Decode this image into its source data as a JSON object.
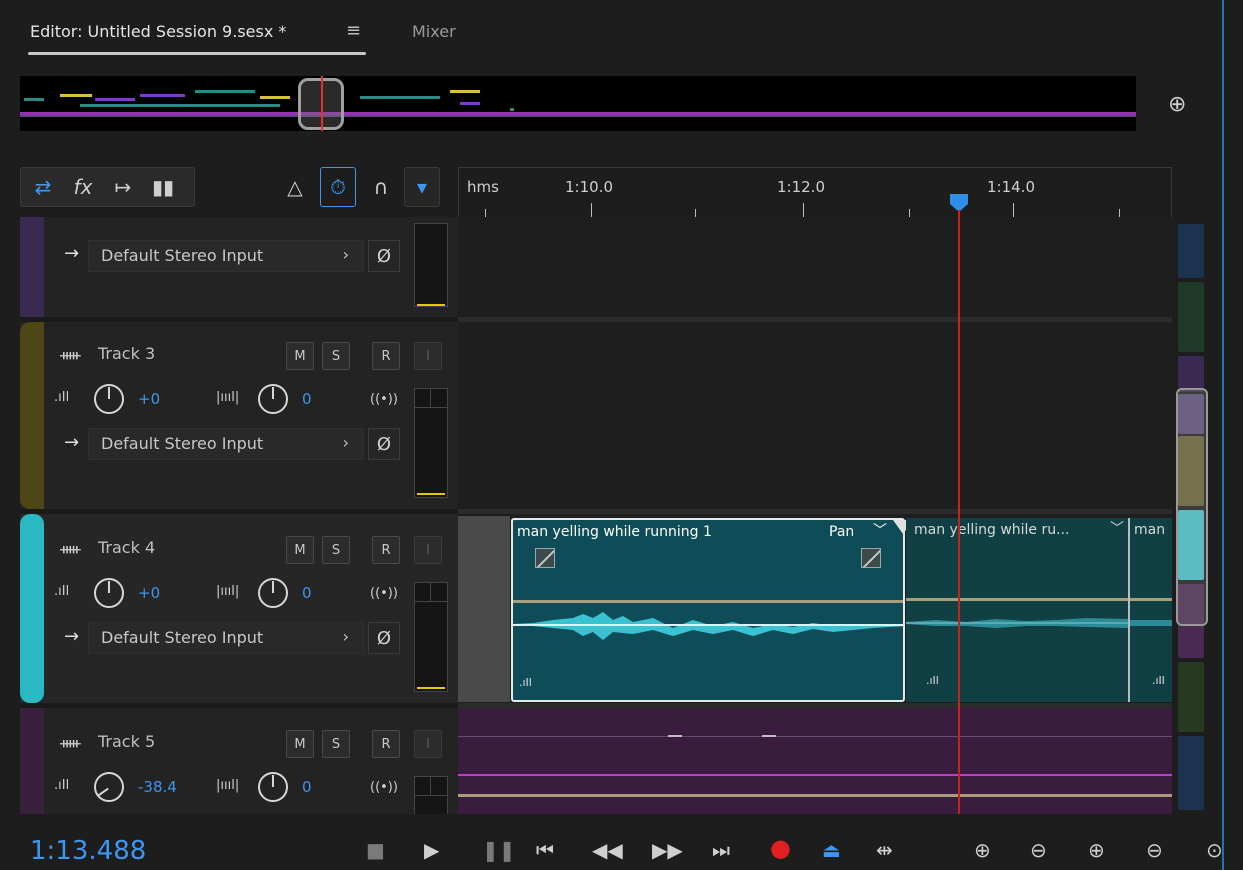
{
  "tabs": {
    "editor_label": "Editor: Untitled Session 9.sesx *",
    "menu_icon": "≡",
    "mixer_label": "Mixer"
  },
  "ruler": {
    "labels": [
      "hms",
      "1:10.0",
      "1:12.0",
      "1:14.0"
    ]
  },
  "tracks": [
    {
      "id": "track-2",
      "name": "",
      "color": "#3a2a52",
      "input": "Default Stereo Input"
    },
    {
      "id": "track-3",
      "name": "Track 3",
      "color": "#4e4615",
      "volume": "+0",
      "pan": "0",
      "input": "Default Stereo Input",
      "buttons": [
        "M",
        "S",
        "R",
        "I"
      ]
    },
    {
      "id": "track-4",
      "name": "Track 4",
      "color": "#2ab8c2",
      "volume": "+0",
      "pan": "0",
      "input": "Default Stereo Input",
      "buttons": [
        "M",
        "S",
        "R",
        "I"
      ]
    },
    {
      "id": "track-5",
      "name": "Track 5",
      "color": "#3a1f3f",
      "volume": "-38.4",
      "pan": "0",
      "buttons": [
        "M",
        "S",
        "R",
        "I"
      ]
    }
  ],
  "clips": [
    {
      "title": "man yelling while running 1",
      "pan_label": "Pan",
      "chevron": "﹀"
    },
    {
      "title": "man yelling while ru...",
      "chevron": "﹀"
    },
    {
      "title": "man"
    }
  ],
  "transport": {
    "time": "1:13.488"
  },
  "icons": {
    "arrow": "→",
    "chevron": "›",
    "phase": "Ø",
    "wave": "ᚔ",
    "radio": "((•))"
  },
  "colors": {
    "accent": "#3d96f0",
    "playhead": "#c62222",
    "clip": "#0e4d57",
    "waveform": "#39c3d2",
    "record": "#e02020"
  }
}
